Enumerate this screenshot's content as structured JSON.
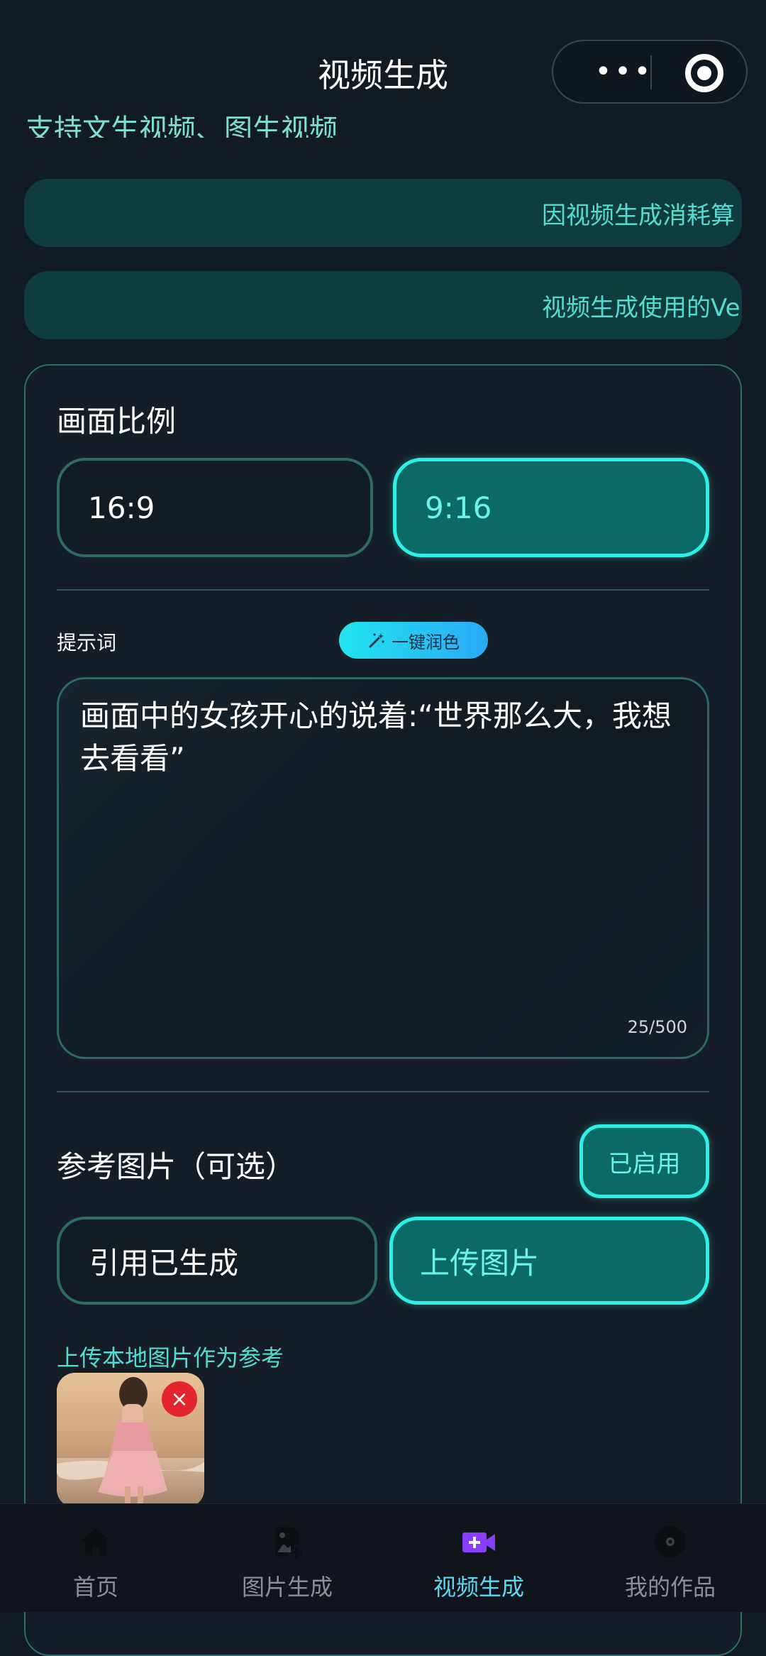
{
  "header": {
    "title": "视频生成",
    "more_glyph": "•••",
    "subtitle_partial": "支持文生视频、图生视频"
  },
  "notices": [
    {
      "text": "因视频生成消耗算"
    },
    {
      "text": "视频生成使用的Ve"
    }
  ],
  "aspect": {
    "title": "画面比例",
    "options": [
      {
        "label": "16:9",
        "selected": false
      },
      {
        "label": "9:16",
        "selected": true
      }
    ]
  },
  "prompt": {
    "label": "提示词",
    "polish_label": "一键润色",
    "polish_icon": "magic-wand-icon",
    "value": "画面中的女孩开心的说着:“世界那么大，我想去看看”",
    "count": "25/500"
  },
  "reference": {
    "title": "参考图片（可选）",
    "toggle_label": "已启用",
    "options": [
      {
        "label": "引用已生成",
        "selected": false
      },
      {
        "label": "上传图片",
        "selected": true
      }
    ],
    "hint": "上传本地图片作为参考",
    "remove_glyph": "×"
  },
  "tabbar": {
    "items": [
      {
        "label": "首页",
        "icon": "home-icon",
        "active": false
      },
      {
        "label": "图片生成",
        "icon": "image-add-icon",
        "active": false
      },
      {
        "label": "视频生成",
        "icon": "video-add-icon",
        "active": true
      },
      {
        "label": "我的作品",
        "icon": "disc-icon",
        "active": false
      }
    ]
  },
  "colors": {
    "background": "#121a22",
    "accent": "#2ff0e6",
    "accent_text": "#55dcd2",
    "active_tab": "#5fd7f0",
    "video_icon": "#8b3dff"
  }
}
